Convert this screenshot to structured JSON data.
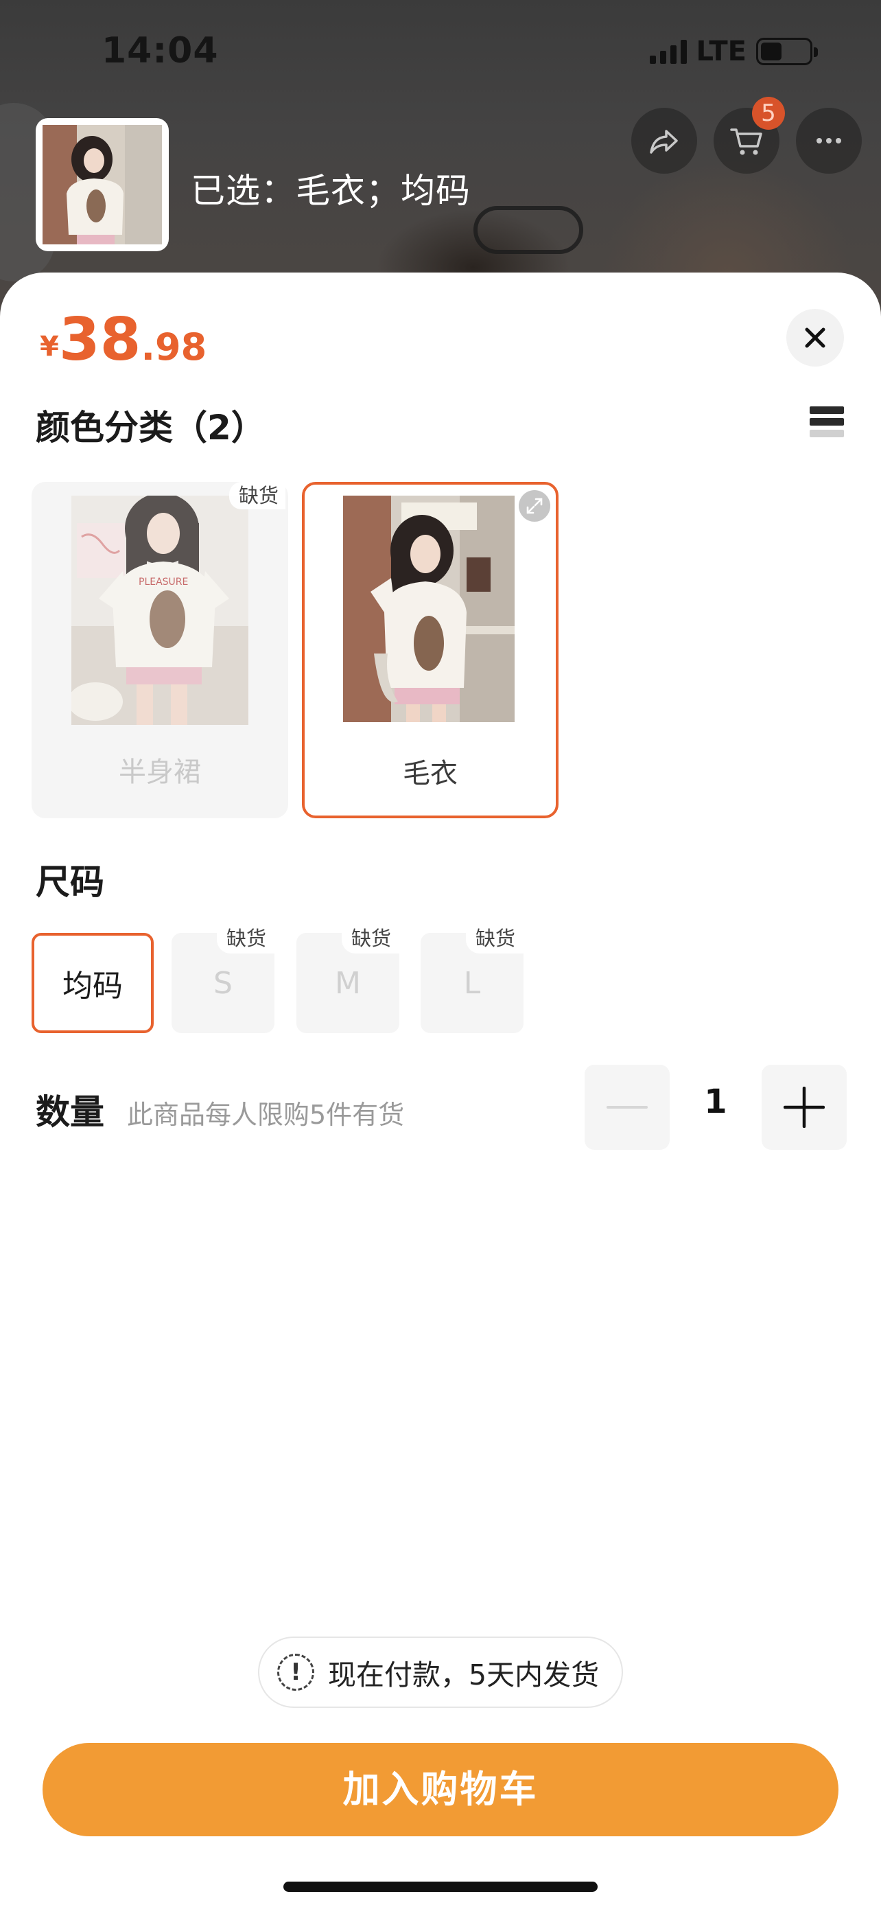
{
  "status_bar": {
    "time": "14:04",
    "network": "LTE"
  },
  "header": {
    "selected_text": "已选：毛衣；均码",
    "cart_badge": "5"
  },
  "product": {
    "price_currency": "¥",
    "price_integer": "38",
    "price_decimal": ".98"
  },
  "color_section": {
    "title": "颜色分类（2）",
    "options": [
      {
        "label": "半身裙",
        "out_of_stock": true,
        "oos_text": "缺货"
      },
      {
        "label": "毛衣",
        "out_of_stock": false,
        "selected": true
      }
    ]
  },
  "size_section": {
    "title": "尺码",
    "options": [
      {
        "label": "均码",
        "selected": true
      },
      {
        "label": "S",
        "oos_text": "缺货"
      },
      {
        "label": "M",
        "oos_text": "缺货"
      },
      {
        "label": "L",
        "oos_text": "缺货"
      }
    ]
  },
  "quantity": {
    "label": "数量",
    "hint": "此商品每人限购5件有货",
    "value": "1"
  },
  "shipping_notice": "现在付款，5天内发货",
  "add_to_cart_label": "加入购物车",
  "colors": {
    "accent": "#e8622e",
    "cta": "#f29b34"
  }
}
